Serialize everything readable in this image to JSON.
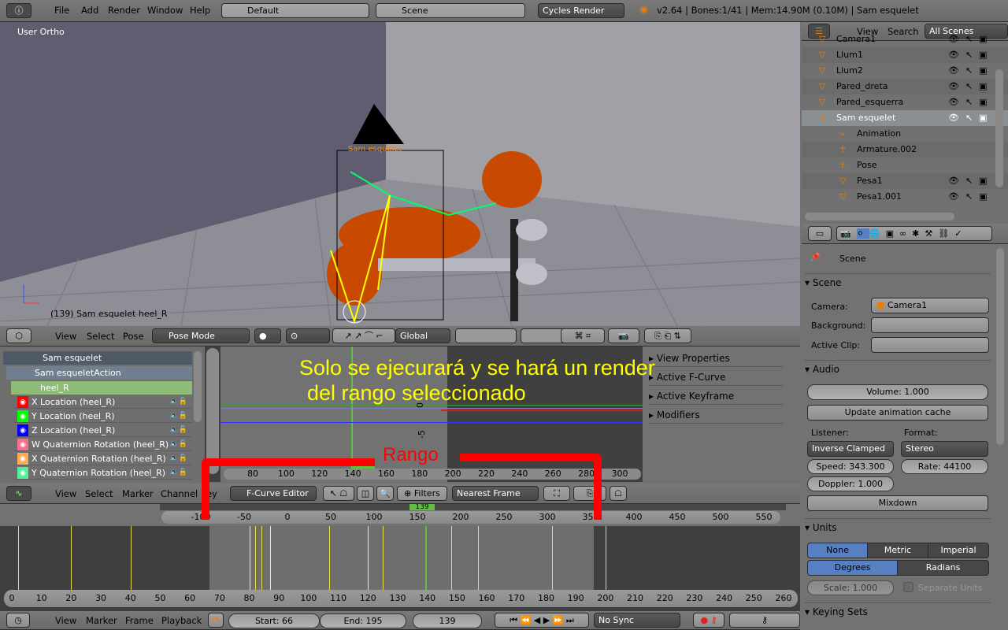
{
  "topbar": {
    "menus": [
      "File",
      "Add",
      "Render",
      "Window",
      "Help"
    ],
    "layout": "Default",
    "scene": "Scene",
    "engine": "Cycles Render",
    "status": "v2.64 | Bones:1/41 | Mem:14.90M (0.10M) | Sam esquelet"
  },
  "viewport": {
    "view_label": "User Ortho",
    "object_label": "Sam esquelet",
    "info": "(139) Sam esquelet heel_R",
    "header": {
      "menus": [
        "View",
        "Select",
        "Pose"
      ],
      "mode": "Pose Mode",
      "orientation": "Global"
    }
  },
  "outliner": {
    "menus": [
      "View",
      "Search"
    ],
    "filter": "All Scenes",
    "items": [
      {
        "name": "Camera1",
        "indent": 0
      },
      {
        "name": "Llum1",
        "indent": 0
      },
      {
        "name": "Llum2",
        "indent": 0
      },
      {
        "name": "Pared_dreta",
        "indent": 0
      },
      {
        "name": "Pared_esquerra",
        "indent": 0
      },
      {
        "name": "Sam esquelet",
        "indent": 0,
        "selected": true
      },
      {
        "name": "Animation",
        "indent": 1
      },
      {
        "name": "Armature.002",
        "indent": 1
      },
      {
        "name": "Pose",
        "indent": 1
      },
      {
        "name": "Pesa1",
        "indent": 1
      },
      {
        "name": "Pesa1.001",
        "indent": 1
      }
    ]
  },
  "properties": {
    "context": "Scene",
    "scene": {
      "title": "Scene",
      "camera_label": "Camera:",
      "camera": "Camera1",
      "background_label": "Background:",
      "clip_label": "Active Clip:"
    },
    "audio": {
      "title": "Audio",
      "volume": "Volume: 1.000",
      "update": "Update animation cache",
      "listener_label": "Listener:",
      "listener": "Inverse Clamped",
      "format_label": "Format:",
      "format": "Stereo",
      "speed": "Speed: 343.300",
      "rate": "Rate: 44100",
      "doppler": "Doppler: 1.000",
      "mixdown": "Mixdown"
    },
    "units": {
      "title": "Units",
      "systems": [
        "None",
        "Metric",
        "Imperial"
      ],
      "system_active": "None",
      "rotation": [
        "Degrees",
        "Radians"
      ],
      "rotation_active": "Degrees",
      "scale": "Scale: 1.000",
      "separate": "Separate Units"
    },
    "keying": {
      "title": "Keying Sets"
    }
  },
  "graph": {
    "channels": {
      "object": "Sam esquelet",
      "action": "Sam esqueletAction",
      "group": "heel_R",
      "curves": [
        {
          "name": "X Location (heel_R)",
          "color": "#ff0000"
        },
        {
          "name": "Y Location (heel_R)",
          "color": "#00ff00"
        },
        {
          "name": "Z Location (heel_R)",
          "color": "#0000ff"
        },
        {
          "name": "W Quaternion Rotation (heel_R)",
          "color": "#ff6b8a"
        },
        {
          "name": "X Quaternion Rotation (heel_R)",
          "color": "#ffaa55"
        },
        {
          "name": "Y Quaternion Rotation (heel_R)",
          "color": "#55ee99"
        }
      ]
    },
    "y_ticks": [
      "5",
      "0",
      "-5"
    ],
    "x_ticks": [
      80,
      100,
      120,
      140,
      160,
      180,
      200,
      220,
      240,
      260,
      280,
      300
    ],
    "current_frame": "139",
    "sidebar": [
      "View Properties",
      "Active F-Curve",
      "Active Keyframe",
      "Modifiers"
    ],
    "header": {
      "menus": [
        "View",
        "Select",
        "Marker",
        "Channel",
        "Key"
      ],
      "mode": "F-Curve Editor",
      "filters": "Filters",
      "snap": "Nearest Frame"
    }
  },
  "annotation": {
    "line1": "Solo se ejecurará y se hará un render",
    "line2": "del rango seleccionado",
    "range": "Rango",
    "color": "#ffff00",
    "range_color": "#ff0000"
  },
  "timeline": {
    "upper_ticks": [
      -100,
      -50,
      0,
      50,
      100,
      150,
      200,
      250,
      300,
      350,
      400,
      450,
      500,
      550
    ],
    "ticks": [
      0,
      10,
      20,
      30,
      40,
      50,
      60,
      70,
      80,
      90,
      100,
      110,
      120,
      130,
      140,
      150,
      160,
      170,
      180,
      190,
      200,
      210,
      220,
      230,
      240,
      250,
      260
    ],
    "start": 66,
    "end": 195,
    "current": 139,
    "keyframes": [
      2,
      20,
      40,
      82,
      84,
      107,
      125,
      148,
      157,
      182,
      200
    ],
    "white_lines": [
      80,
      87,
      120
    ],
    "header": {
      "menus": [
        "View",
        "Marker",
        "Frame",
        "Playback"
      ],
      "start_label": "Start: 66",
      "end_label": "End: 195",
      "frame_label": "139",
      "sync": "No Sync"
    }
  }
}
